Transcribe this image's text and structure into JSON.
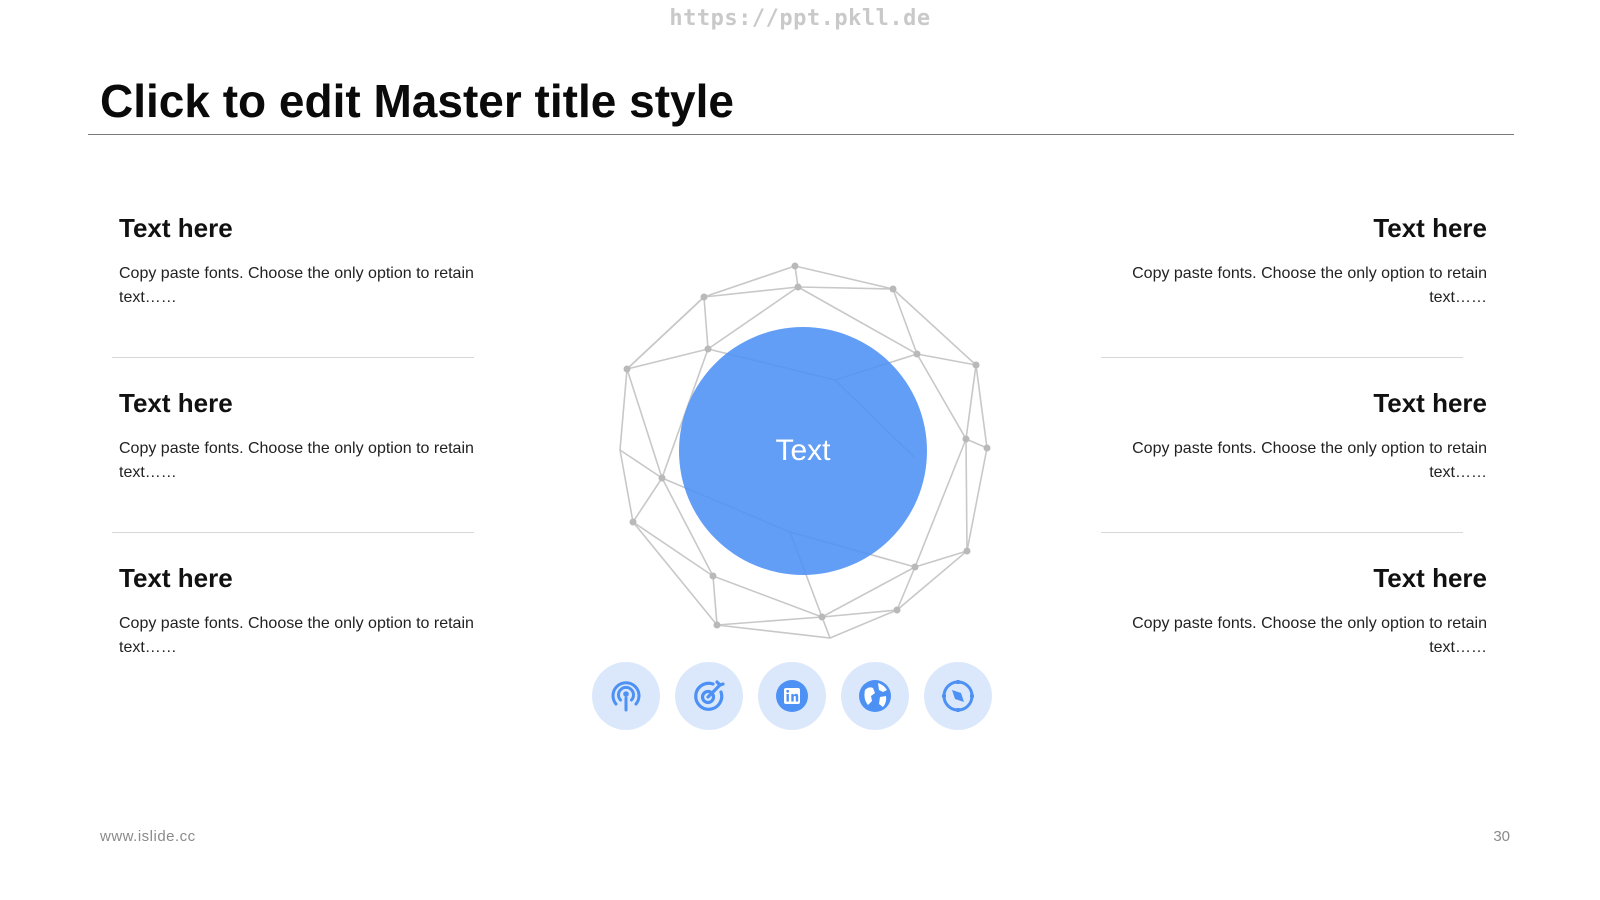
{
  "watermark": "https://ppt.pkll.de",
  "title": "Click to edit Master title style",
  "center_label": "Text",
  "left_blocks": [
    {
      "heading": "Text here",
      "body": "Copy paste fonts. Choose the only option to retain text……"
    },
    {
      "heading": "Text here",
      "body": "Copy paste fonts. Choose the only option to retain text……"
    },
    {
      "heading": "Text here",
      "body": "Copy paste fonts. Choose the only option to retain text……"
    }
  ],
  "right_blocks": [
    {
      "heading": "Text here",
      "body": "Copy paste fonts. Choose the only option to retain text……"
    },
    {
      "heading": "Text here",
      "body": "Copy paste fonts. Choose the only option to retain text……"
    },
    {
      "heading": "Text here",
      "body": "Copy paste fonts. Choose the only option to retain text……"
    }
  ],
  "icons": [
    "podcast-icon",
    "target-icon",
    "linkedin-icon",
    "globe-icon",
    "compass-icon"
  ],
  "footer": {
    "website": "www.islide.cc",
    "page_number": "30"
  },
  "colors": {
    "accent": "#4d91f5",
    "icon_bg": "#dbe8fb",
    "mesh": "#c8c8c8"
  }
}
